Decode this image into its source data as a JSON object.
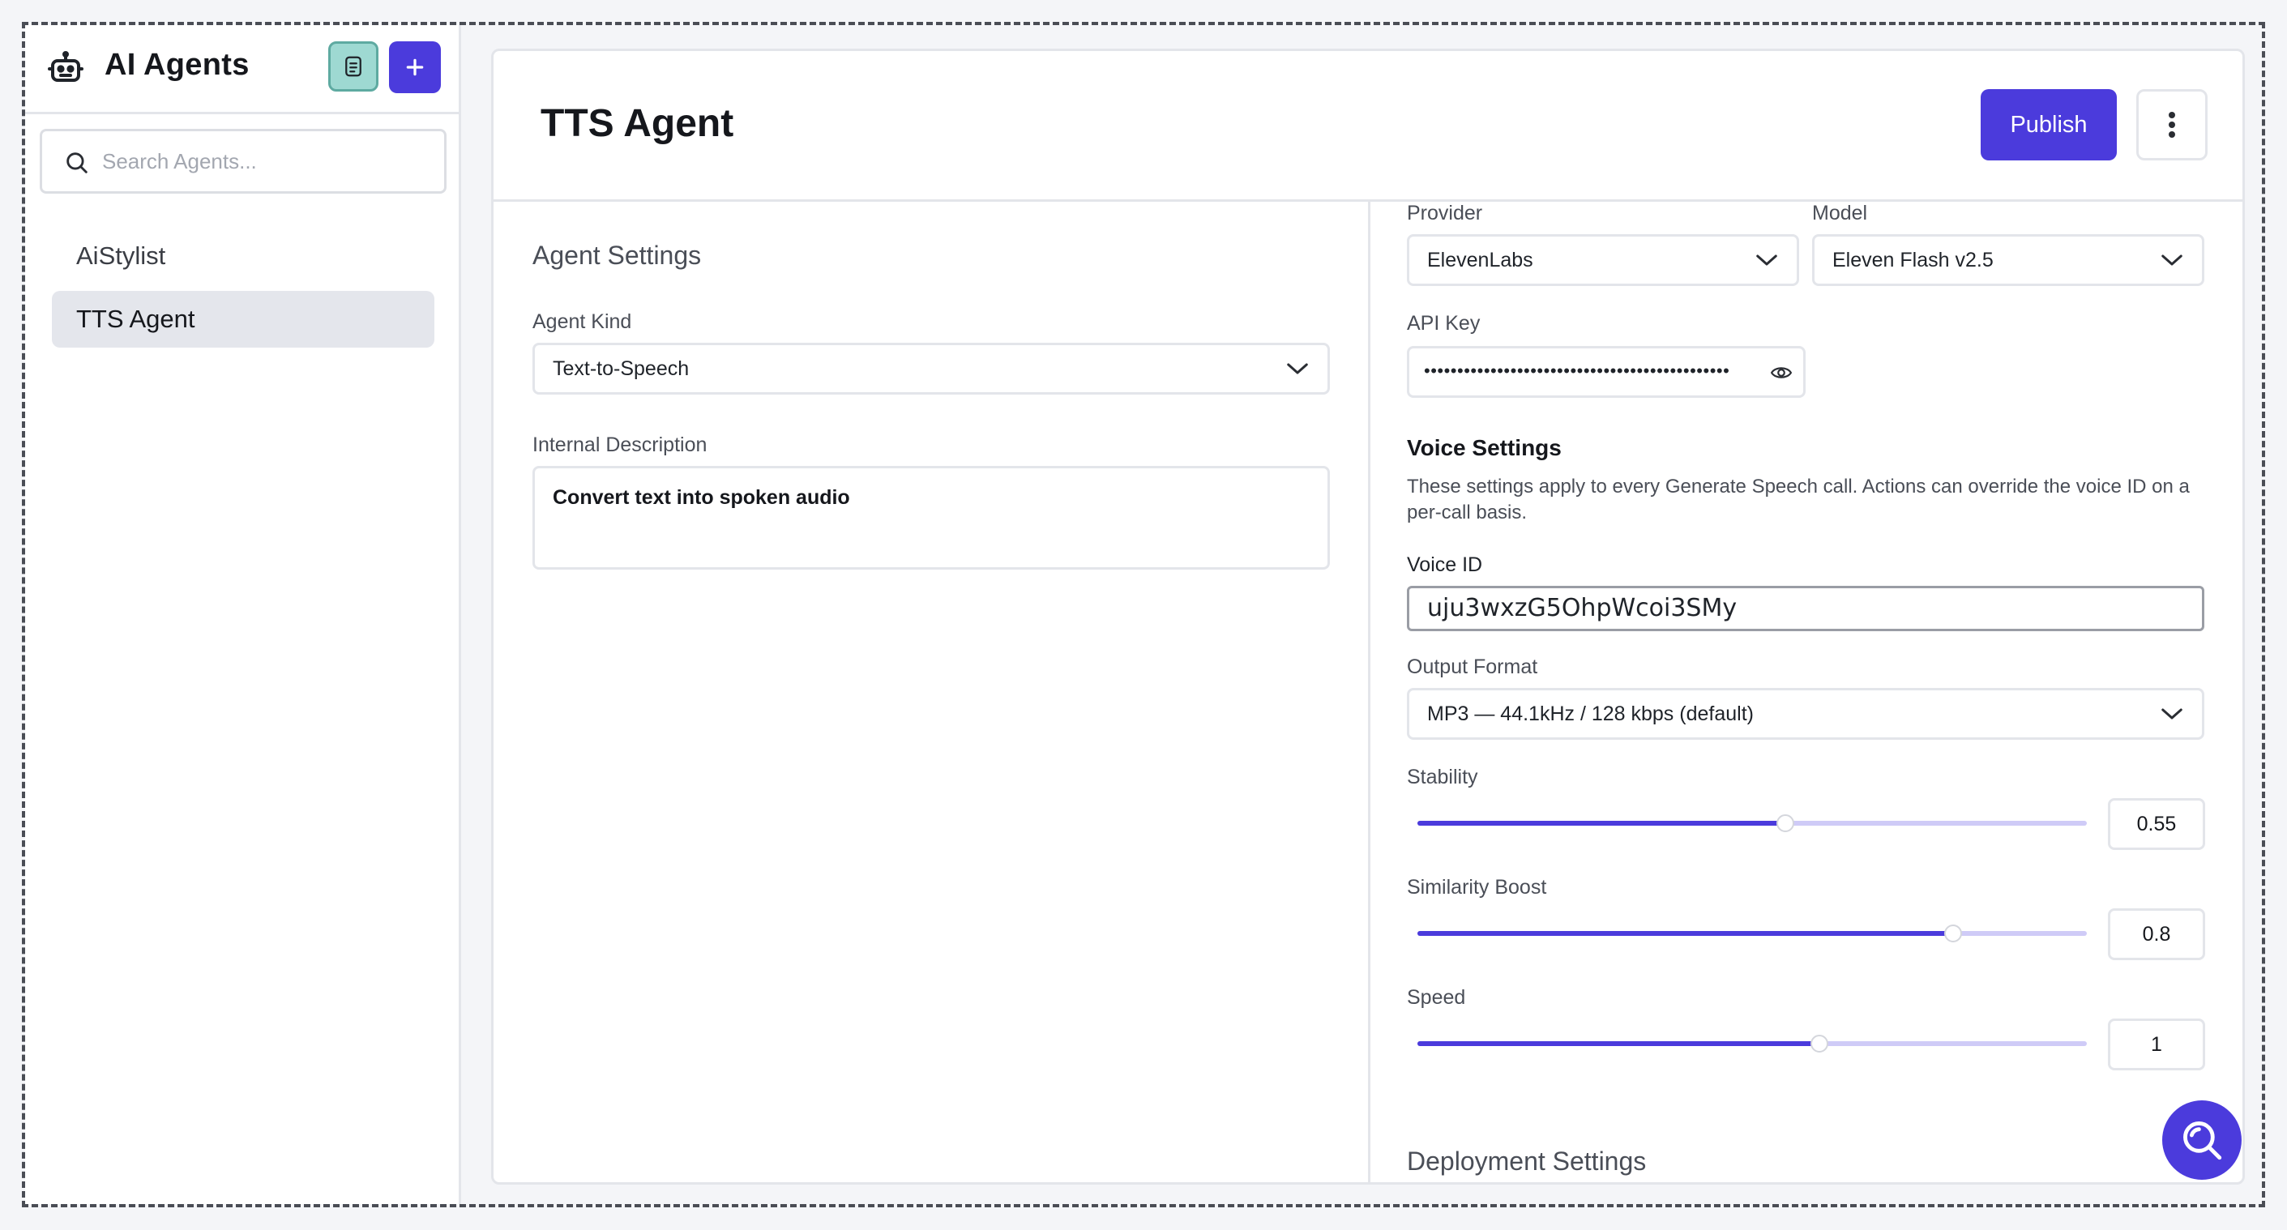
{
  "sidebar": {
    "title": "AI Agents",
    "search_placeholder": "Search Agents...",
    "items": [
      {
        "label": "AiStylist",
        "active": false
      },
      {
        "label": "TTS Agent",
        "active": true
      }
    ]
  },
  "header": {
    "title": "TTS Agent",
    "publish_label": "Publish"
  },
  "agent_settings": {
    "title": "Agent Settings",
    "kind_label": "Agent Kind",
    "kind_value": "Text-to-Speech",
    "description_label": "Internal Description",
    "description_value": "Convert text into spoken audio"
  },
  "provider": {
    "label": "Provider",
    "value": "ElevenLabs"
  },
  "model": {
    "label": "Model",
    "value": "Eleven Flash v2.5"
  },
  "api_key": {
    "label": "API Key",
    "masked_value": "••••••••••••••••••••••••••••••••••••••••••••••"
  },
  "voice_settings": {
    "title": "Voice Settings",
    "description": "These settings apply to every Generate Speech call. Actions can override the voice ID on a per-call basis.",
    "voice_id_label": "Voice ID",
    "voice_id_value": "uju3wxzG5OhpWcoi3SMy",
    "output_format_label": "Output Format",
    "output_format_value": "MP3 — 44.1kHz / 128 kbps (default)",
    "sliders": [
      {
        "label": "Stability",
        "value": "0.55",
        "fill_fraction": 0.55
      },
      {
        "label": "Similarity Boost",
        "value": "0.8",
        "fill_fraction": 0.8
      },
      {
        "label": "Speed",
        "value": "1",
        "fill_fraction": 0.6
      }
    ]
  },
  "deployment": {
    "title": "Deployment Settings"
  },
  "colors": {
    "accent": "#4b3bdc",
    "doc_button": "#9ed9d2"
  },
  "icons": {
    "logo": "robot-icon",
    "doc": "document-icon",
    "add": "plus-icon",
    "search": "search-icon",
    "more": "more-vertical-icon",
    "chevron": "chevron-down-icon",
    "eye": "eye-icon",
    "fab": "search-icon"
  }
}
